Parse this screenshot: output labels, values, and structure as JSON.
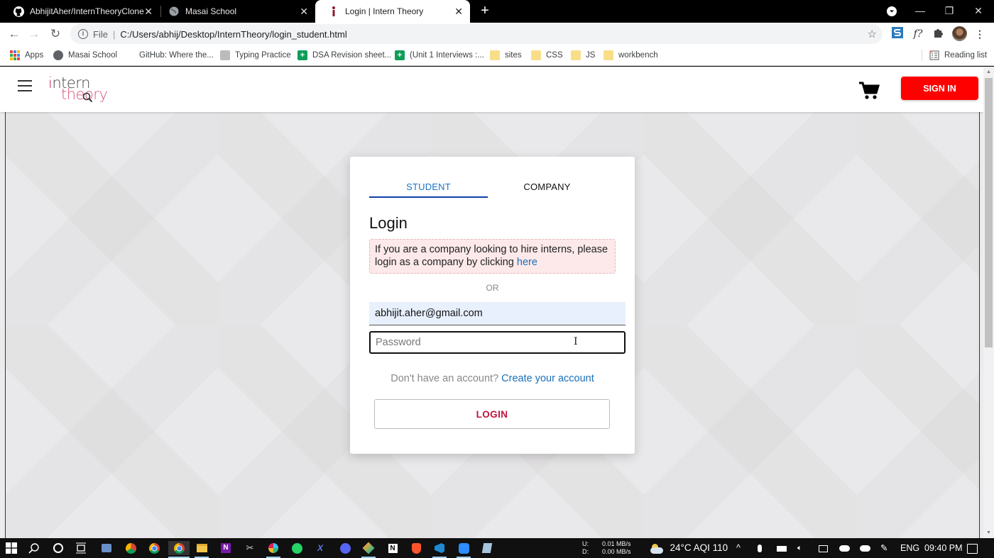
{
  "browser": {
    "tabs": [
      {
        "title": "AbhijitAher/InternTheoryClone",
        "icon": "github-icon",
        "active": false
      },
      {
        "title": "Masai School",
        "icon": "globe-icon",
        "active": false
      },
      {
        "title": "Login | Intern Theory",
        "icon": "intern-theory-favicon",
        "active": true
      }
    ],
    "new_tab_label": "+",
    "window_controls": {
      "minimize": "—",
      "maximize": "❐",
      "close": "✕"
    },
    "url_scheme": "File",
    "url": "C:/Users/abhij/Desktop/InternTheory/login_student.html",
    "bookmarks": [
      {
        "label": "Apps",
        "icon": "apps-grid-icon"
      },
      {
        "label": "Masai School",
        "icon": "globe-icon"
      },
      {
        "label": "GitHub: Where the...",
        "icon": "none"
      },
      {
        "label": "Typing Practice",
        "icon": "typing-icon"
      },
      {
        "label": "DSA Revision sheet...",
        "icon": "sheets-icon"
      },
      {
        "label": "(Unit 1 Interviews :...",
        "icon": "sheets-icon"
      },
      {
        "label": "sites",
        "icon": "folder-icon"
      },
      {
        "label": "CSS",
        "icon": "folder-icon"
      },
      {
        "label": "JS",
        "icon": "folder-icon"
      },
      {
        "label": "workbench",
        "icon": "folder-icon"
      }
    ],
    "reading_list_label": "Reading list"
  },
  "site": {
    "logo_line1_i": "i",
    "logo_line1_rest": "ntern",
    "logo_line2": "theory",
    "signin_label": "SIGN IN"
  },
  "login_card": {
    "tabs": [
      {
        "label": "STUDENT",
        "active": true
      },
      {
        "label": "COMPANY",
        "active": false
      }
    ],
    "title": "Login",
    "notice_text": "If you are a company looking to hire interns, please login as a company by clicking ",
    "notice_link": "here",
    "or_label": "OR",
    "email_value": "abhijit.aher@gmail.com",
    "password_placeholder": "Password",
    "signup_prompt": "Don't have an account? ",
    "signup_link": "Create your account",
    "login_button": "LOGIN"
  },
  "taskbar": {
    "net_up_label": "U:",
    "net_up_value": "0.01 MB/s",
    "net_down_label": "D:",
    "net_down_value": "0.00 MB/s",
    "weather": "24°C  AQI 110",
    "language": "ENG",
    "time": "09:40 PM"
  },
  "colors": {
    "signin_bg": "#ff0000",
    "active_tab": "#1a73c5",
    "link": "#1a6fb8",
    "login_text": "#c0143c",
    "notice_bg": "#fde9ea"
  }
}
